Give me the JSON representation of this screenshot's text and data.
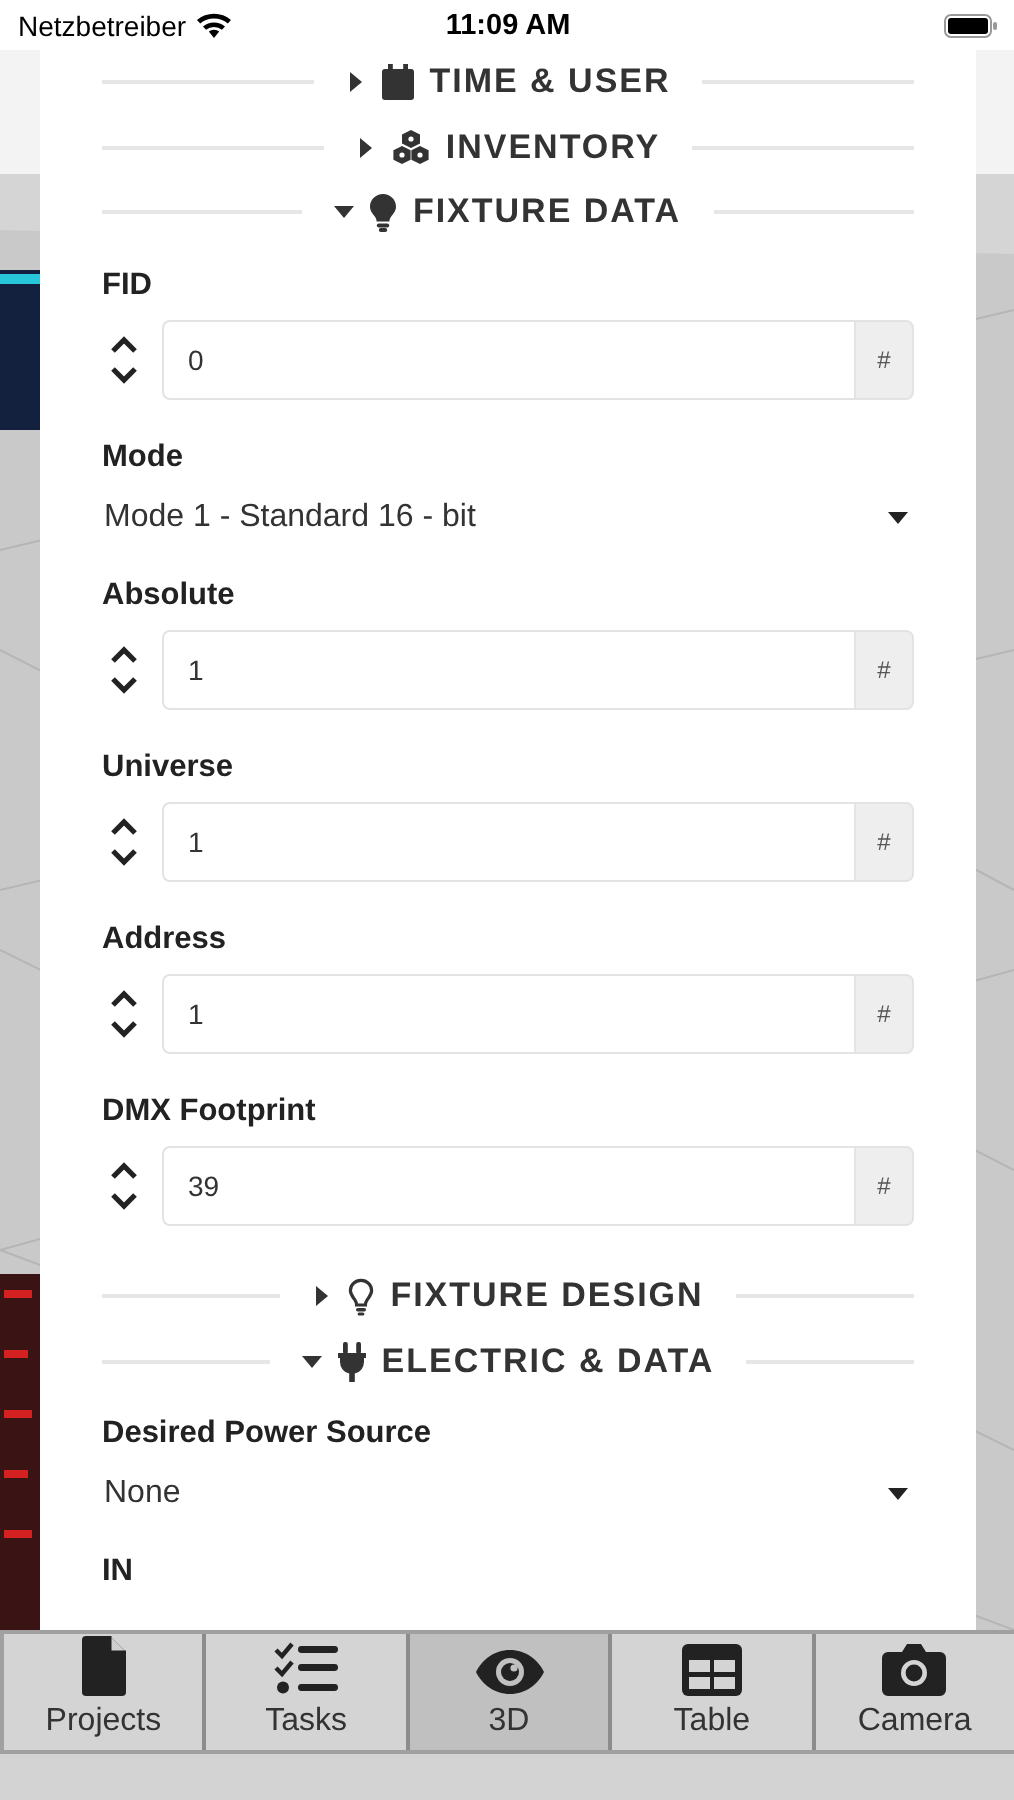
{
  "status_bar": {
    "carrier": "Netzbetreiber",
    "time": "11:09 AM"
  },
  "sections": [
    {
      "title": "TIME & USER",
      "expanded": false
    },
    {
      "title": "INVENTORY",
      "expanded": false
    },
    {
      "title": "FIXTURE DATA",
      "expanded": true,
      "fields": [
        {
          "kind": "number",
          "label": "FID",
          "value": "0",
          "unit": "#"
        },
        {
          "kind": "select",
          "label": "Mode",
          "value": "Mode 1 - Standard 16 - bit"
        },
        {
          "kind": "number",
          "label": "Absolute",
          "value": "1",
          "unit": "#"
        },
        {
          "kind": "number",
          "label": "Universe",
          "value": "1",
          "unit": "#"
        },
        {
          "kind": "number",
          "label": "Address",
          "value": "1",
          "unit": "#"
        },
        {
          "kind": "number",
          "label": "DMX Footprint",
          "value": "39",
          "unit": "#"
        }
      ]
    },
    {
      "title": "FIXTURE DESIGN",
      "expanded": false
    },
    {
      "title": "ELECTRIC & DATA",
      "expanded": true,
      "fields": [
        {
          "kind": "select",
          "label": "Desired Power Source",
          "value": "None"
        },
        {
          "kind": "label",
          "label": "IN"
        }
      ]
    }
  ],
  "tabs": [
    {
      "label": "Projects",
      "selected": false
    },
    {
      "label": "Tasks",
      "selected": false
    },
    {
      "label": "3D",
      "selected": true
    },
    {
      "label": "Table",
      "selected": false
    },
    {
      "label": "Camera",
      "selected": false
    }
  ]
}
